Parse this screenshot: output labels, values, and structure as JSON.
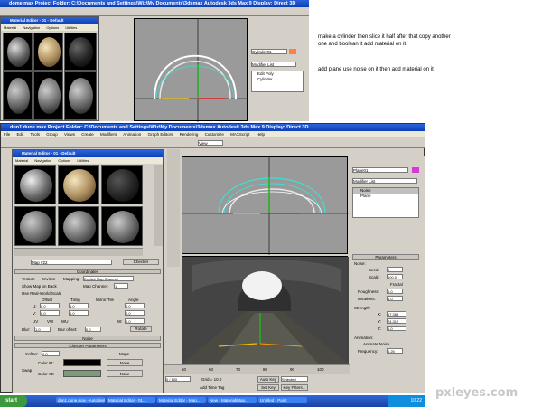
{
  "top_window": {
    "title": "dome.max   Project Folder: C:\\Documents and Settings\\Wiz\\My Documents\\3dsmax   Autodesk 3ds Max 9   Display: Direct 3D",
    "editor_title": "Material Editor - 01 - Default",
    "editor_menu": [
      "Material",
      "Navigation",
      "Options",
      "Utilities"
    ],
    "object_name": "Cylinder01",
    "modifier_list": "Modifier List",
    "stack_items": [
      "Edit Poly",
      "Cylinder"
    ]
  },
  "instructions": {
    "line1": "make a cylinder then slice it half after that copy another",
    "line2": "one and boolean it add material on it.",
    "line3": "add plane use noise on it then add  material on it"
  },
  "main_window": {
    "title": "dun1 dune.max   Project Folder: C:\\Documents and Settings\\Wiz\\My Documents\\3dsmax   Autodesk 3ds Max 9   Display: Direct 3D",
    "menu": [
      "File",
      "Edit",
      "Tools",
      "Group",
      "Views",
      "Create",
      "Modifiers",
      "Animation",
      "Graph Editors",
      "Rendering",
      "Customize",
      "MAXScript",
      "Help"
    ],
    "view_dropdown": "View",
    "material_editor": {
      "title": "Material Editor - 01 - Default",
      "menu": [
        "Material",
        "Navigation",
        "Options",
        "Utilities"
      ],
      "material_name": "Map #22",
      "map_type": "Checker",
      "coordinates_header": "Coordinates",
      "texture_label": "Texture",
      "environ_label": "Environ",
      "mapping_label": "Mapping:",
      "mapping_value": "Explicit Map Channel",
      "map_channel_label": "Map Channel:",
      "map_channel_value": "1",
      "show_map_label": "Show Map on Back",
      "use_real_label": "Use Real-World Scale",
      "offset_label": "Offset",
      "tiling_label": "Tiling",
      "mirror_label": "Mirror Tile",
      "angle_label": "Angle",
      "u_offset": "0.0",
      "v_offset": "0.0",
      "u_tiling": "1.0",
      "v_tiling": "1.0",
      "u_angle": "0.0",
      "v_angle": "0.0",
      "w_angle": "0.0",
      "uv_label": "UV",
      "vw_label": "VW",
      "wu_label": "WU",
      "blur_label": "Blur:",
      "blur_value": "1.0",
      "blur_offset_label": "Blur offset:",
      "blur_offset_value": "0.0",
      "rotate_label": "Rotate",
      "noise_header": "Noise",
      "checker_header": "Checker Parameters",
      "soften_label": "Soften:",
      "soften_value": "0.0",
      "swap_label": "Swap",
      "color1_label": "Color #1:",
      "color2_label": "Color #2:",
      "maps_label": "Maps",
      "none1": "None",
      "none2": "None"
    },
    "command_panel": {
      "object_name": "Plane01",
      "modifier_list": "Modifier List",
      "stack_items": [
        "Noise",
        "Plane"
      ],
      "parameters_header": "Parameters",
      "noise_group": "Noise:",
      "seed_label": "Seed:",
      "seed_value": "0",
      "scale_label": "Scale:",
      "scale_value": "100.0",
      "fractal_label": "Fractal",
      "roughness_label": "Roughness:",
      "roughness_value": "0.0",
      "iterations_label": "Iterations:",
      "iterations_value": "6.0",
      "strength_group": "Strength:",
      "x_label": "X:",
      "x_value": "17.363",
      "y_label": "Y:",
      "y_value": "24.312",
      "z_label": "Z:",
      "z_value": "0.0",
      "animation_group": "Animation:",
      "animate_noise_label": "Animate Noise",
      "frequency_label": "Frequency:",
      "frequency_value": "0.25"
    },
    "timeline": {
      "frame": "0 / 100",
      "ticks": [
        "50",
        "60",
        "70",
        "80",
        "90",
        "100"
      ]
    },
    "status": {
      "grid": "Grid = 10.0",
      "add_time_tag": "Add Time Tag",
      "auto_key": "Auto Key",
      "selected": "Selected",
      "set_key": "Set Key",
      "key_filters": "Key Filters..."
    }
  },
  "taskbar": {
    "start": "start",
    "tasks": [
      "dun1 dune.max - Autodesk...",
      "Material Editor - 01...",
      "Material Editor - Map...",
      "New - Material/Map...",
      "Untitled - Paint"
    ],
    "clock": "10:22"
  },
  "watermark": "pxleyes.com",
  "colors": {
    "title_blue": "#0a3fb8",
    "panel_grey": "#d4d0c8",
    "viewport_grey": "#9a9a9a",
    "wire_cyan": "#3fe0d0",
    "tunnel_dark": "#2a2a2a",
    "color2_swatch": "#7a9a7a",
    "taskbar_blue": "#245edb"
  }
}
